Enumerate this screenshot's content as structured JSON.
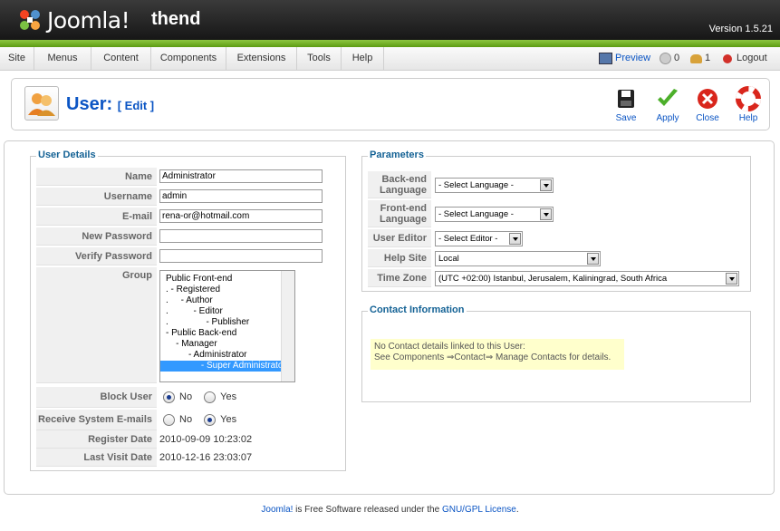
{
  "header": {
    "logo_text": "Joomla!",
    "site_name": "thend",
    "version": "Version 1.5.21"
  },
  "menu": {
    "items": [
      "Site",
      "Menus",
      "Content",
      "Components",
      "Extensions",
      "Tools",
      "Help"
    ]
  },
  "status": {
    "preview": "Preview",
    "messages_count": "0",
    "users_count": "1",
    "logout": "Logout"
  },
  "toolbar": {
    "title": "User:",
    "subtitle": "[ Edit ]",
    "save": "Save",
    "apply": "Apply",
    "close": "Close",
    "help": "Help"
  },
  "user_details": {
    "legend": "User Details",
    "name_label": "Name",
    "name_value": "Administrator",
    "username_label": "Username",
    "username_value": "admin",
    "email_label": "E-mail",
    "email_value": "rena-or@hotmail.com",
    "new_password_label": "New Password",
    "verify_password_label": "Verify Password",
    "group_label": "Group",
    "groups": [
      "Public Front-end",
      ". - Registered",
      ".     - Author",
      ".          - Editor",
      ".               - Publisher",
      "- Public Back-end",
      "    - Manager",
      "         - Administrator",
      "              - Super Administrator"
    ],
    "selected_group": "- Super Administrator",
    "block_user_label": "Block User",
    "block_user_value": "No",
    "receive_email_label": "Receive System E-mails",
    "receive_email_value": "Yes",
    "no_label": "No",
    "yes_label": "Yes",
    "register_date_label": "Register Date",
    "register_date_value": "2010-09-09 10:23:02",
    "last_visit_label": "Last Visit Date",
    "last_visit_value": "2010-12-16 23:03:07"
  },
  "parameters": {
    "legend": "Parameters",
    "backend_lang_label_1": "Back-end",
    "backend_lang_label_2": "Language",
    "backend_lang_value": "- Select Language -",
    "frontend_lang_label_1": "Front-end",
    "frontend_lang_label_2": "Language",
    "frontend_lang_value": "- Select Language -",
    "user_editor_label": "User Editor",
    "user_editor_value": "- Select Editor -",
    "help_site_label": "Help Site",
    "help_site_value": "Local",
    "time_zone_label": "Time Zone",
    "time_zone_value": "(UTC +02:00) Istanbul, Jerusalem, Kaliningrad, South Africa"
  },
  "contact": {
    "legend": "Contact Information",
    "line1": "No Contact details linked to this User:",
    "line2": "See Components ⇒Contact⇒ Manage Contacts for details."
  },
  "footer": {
    "joomla": "Joomla!",
    "text": " is Free Software released under the ",
    "license": "GNU/GPL License",
    "end": "."
  }
}
